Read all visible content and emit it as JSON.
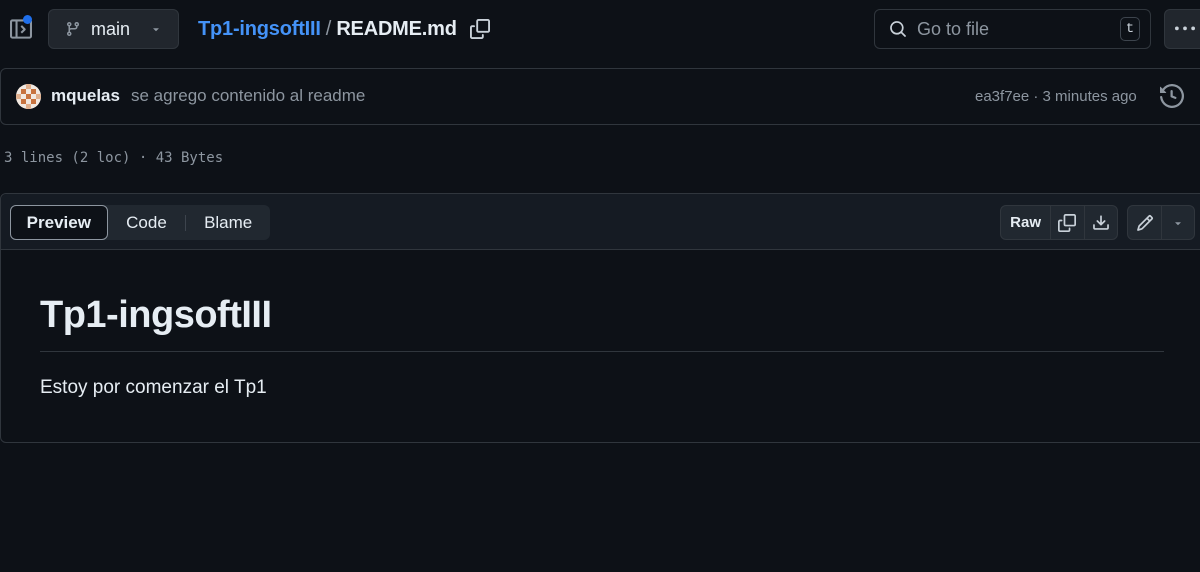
{
  "topbar": {
    "branch": "main",
    "repo": "Tp1-ingsoftIII",
    "separator": "/",
    "file": "README.md",
    "goto_placeholder": "Go to file",
    "goto_shortcut": "t"
  },
  "commit": {
    "author": "mquelas",
    "message": "se agrego contenido al readme",
    "meta": "ea3f7ee · 3 minutes ago"
  },
  "file_info": "3 lines (2 loc) · 43 Bytes",
  "view_tabs": [
    {
      "label": "Preview",
      "active": true
    },
    {
      "label": "Code",
      "active": false
    },
    {
      "label": "Blame",
      "active": false
    }
  ],
  "actions": {
    "raw_label": "Raw"
  },
  "markdown": {
    "heading": "Tp1-ingsoftIII",
    "paragraph": "Estoy por comenzar el Tp1"
  },
  "colors": {
    "background": "#0d1117",
    "link": "#4493f8",
    "muted": "#8d96a0",
    "border": "#30363d",
    "notification_dot": "#1f6feb"
  },
  "icons": [
    "sidebar-toggle-icon",
    "branch-icon",
    "caret-down-icon",
    "copy-icon",
    "search-icon",
    "kebab-icon",
    "history-icon",
    "download-icon",
    "pencil-icon"
  ]
}
